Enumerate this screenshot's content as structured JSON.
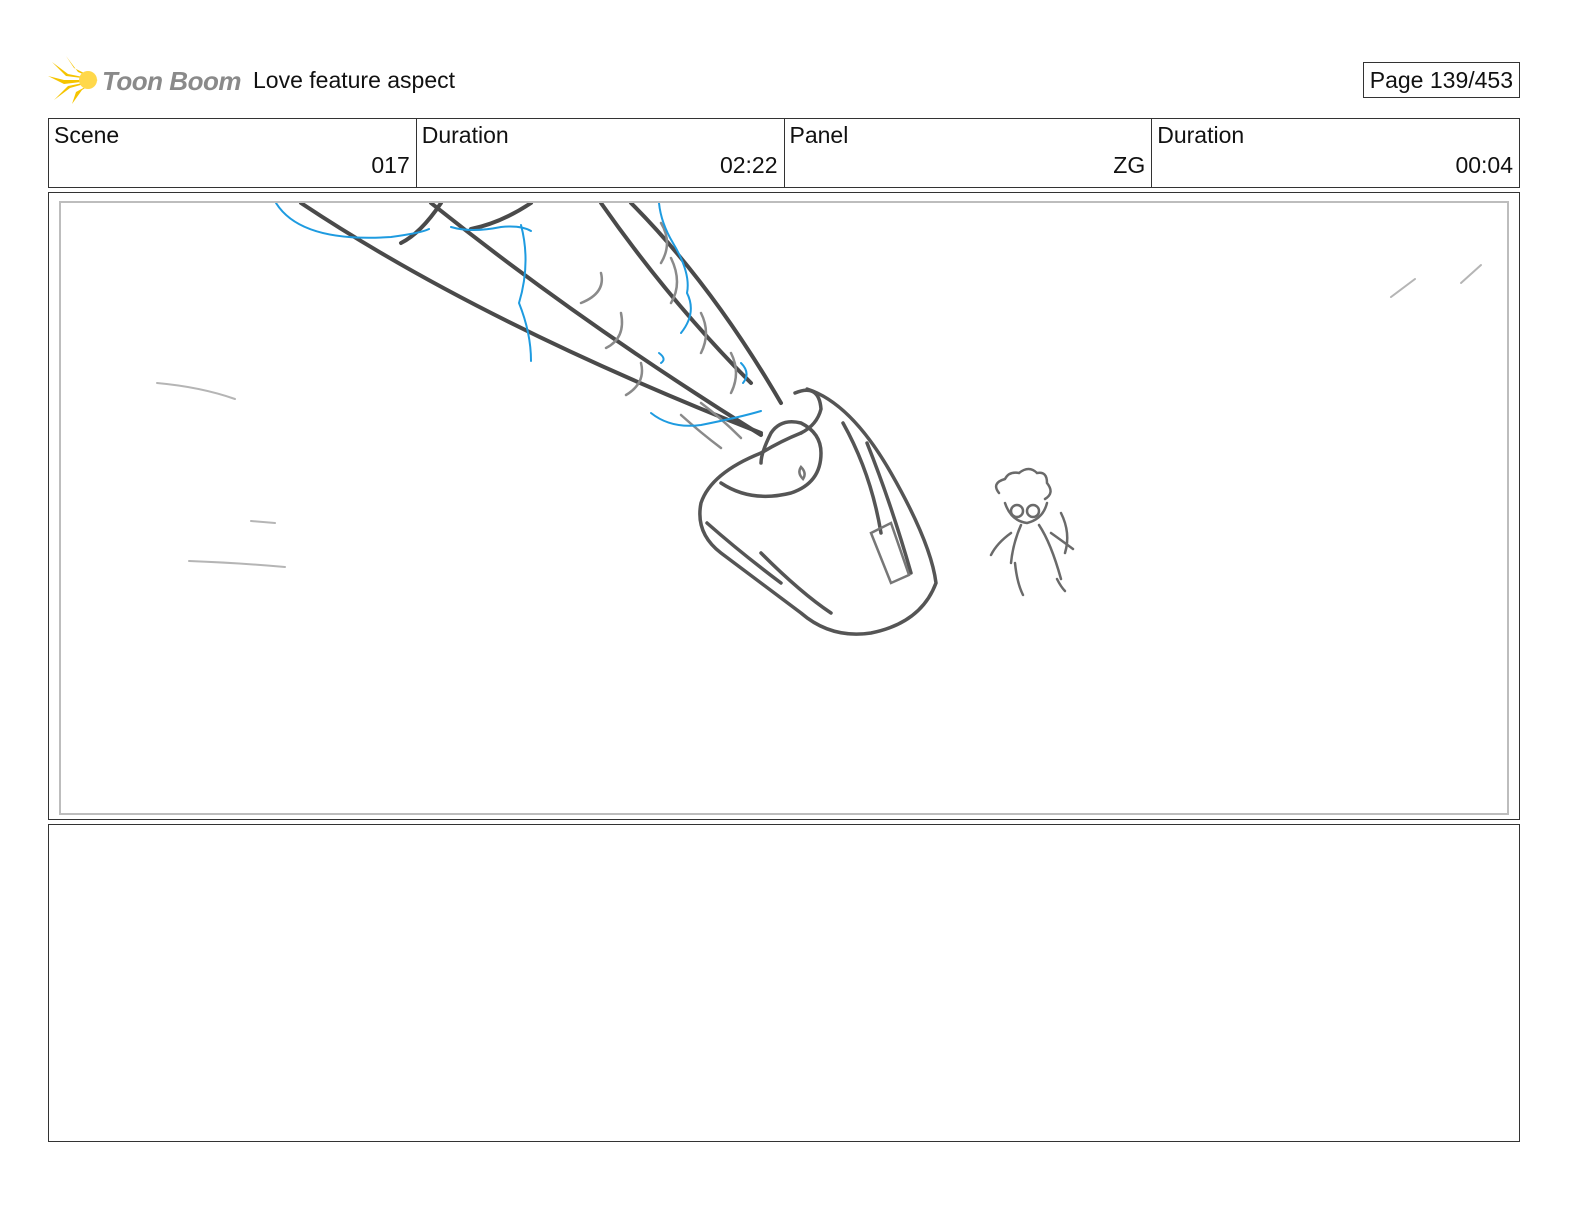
{
  "header": {
    "logo_text": "Toon Boom",
    "project_title": "Love feature aspect",
    "page_label": "Page 139/453"
  },
  "info": {
    "scene_label": "Scene",
    "scene_value": "017",
    "duration_label": "Duration",
    "duration_value": "02:22",
    "panel_label": "Panel",
    "panel_value": "ZG",
    "panel_duration_label": "Duration",
    "panel_duration_value": "00:04"
  },
  "colors": {
    "logo_yellow": "#f5c400",
    "sketch_gray": "#555555",
    "sketch_blue": "#1e9be0"
  }
}
